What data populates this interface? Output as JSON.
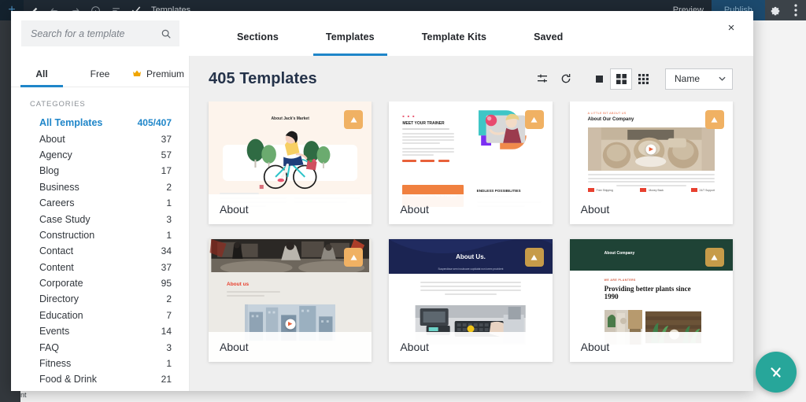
{
  "editor": {
    "add_label": "+",
    "doc_title": "Templates",
    "preview_label": "Preview",
    "publish_label": "Publish",
    "icons": {
      "pencil": "pencil-icon",
      "undo": "undo-icon",
      "redo": "redo-icon",
      "info": "info-icon",
      "history": "history-icon",
      "check": "check-icon",
      "gear": "gear-icon",
      "kebab": "more-vertical-icon"
    },
    "canvas_hint": "nt"
  },
  "search": {
    "placeholder": "Search for a template",
    "value": "",
    "icon": "search-icon"
  },
  "modal": {
    "close_label": "×",
    "tabs": [
      {
        "label": "Sections",
        "active": false
      },
      {
        "label": "Templates",
        "active": true
      },
      {
        "label": "Template Kits",
        "active": false
      },
      {
        "label": "Saved",
        "active": false
      }
    ]
  },
  "sidebar": {
    "filters": [
      {
        "label": "All",
        "active": true,
        "icon": null
      },
      {
        "label": "Free",
        "active": false,
        "icon": null
      },
      {
        "label": "Premium",
        "active": false,
        "icon": "crown-icon"
      }
    ],
    "categories_heading": "CATEGORIES",
    "categories": [
      {
        "name": "All Templates",
        "count": "405/407",
        "active": true
      },
      {
        "name": "About",
        "count": "37",
        "active": false
      },
      {
        "name": "Agency",
        "count": "57",
        "active": false
      },
      {
        "name": "Blog",
        "count": "17",
        "active": false
      },
      {
        "name": "Business",
        "count": "2",
        "active": false
      },
      {
        "name": "Careers",
        "count": "1",
        "active": false
      },
      {
        "name": "Case Study",
        "count": "3",
        "active": false
      },
      {
        "name": "Construction",
        "count": "1",
        "active": false
      },
      {
        "name": "Contact",
        "count": "34",
        "active": false
      },
      {
        "name": "Content",
        "count": "37",
        "active": false
      },
      {
        "name": "Corporate",
        "count": "95",
        "active": false
      },
      {
        "name": "Directory",
        "count": "2",
        "active": false
      },
      {
        "name": "Education",
        "count": "7",
        "active": false
      },
      {
        "name": "Events",
        "count": "14",
        "active": false
      },
      {
        "name": "FAQ",
        "count": "3",
        "active": false
      },
      {
        "name": "Fitness",
        "count": "1",
        "active": false
      },
      {
        "name": "Food & Drink",
        "count": "21",
        "active": false
      }
    ]
  },
  "content": {
    "results_title": "405 Templates",
    "toolbar": {
      "filter_icon": "filter-sliders-icon",
      "refresh_icon": "refresh-icon",
      "view_single_icon": "view-single-icon",
      "view_grid2_icon": "view-grid-2x2-icon",
      "view_grid3_icon": "view-grid-3x3-icon",
      "active_view": "grid2",
      "sort_value": "Name",
      "sort_caret": "∨"
    },
    "cards": [
      {
        "title": "About",
        "badge": "premium-badge-icon",
        "preview_heading": "About Jack's Market",
        "style": "c1"
      },
      {
        "title": "About",
        "badge": "premium-badge-icon",
        "preview_heading": "MEET YOUR TRAINER",
        "preview_subheading": "ENDLESS POSSIBILITIES",
        "style": "c2"
      },
      {
        "title": "About",
        "badge": "premium-badge-icon",
        "preview_eyebrow": "A LITTLE BIT ABOUT US",
        "preview_heading": "About Our Company",
        "preview_features": [
          "Free Shipping",
          "Money Back",
          "24/7 Support"
        ],
        "style": "c3"
      },
      {
        "title": "About",
        "badge": "premium-badge-icon",
        "preview_heading": "About us",
        "style": "c4"
      },
      {
        "title": "About",
        "badge": "premium-badge-icon",
        "preview_heading": "About Us.",
        "preview_subheading": "Suspendisse sem incubuare cupidatat non lorem provident",
        "style": "c5"
      },
      {
        "title": "About",
        "badge": "premium-badge-icon",
        "preview_heading": "About Company",
        "preview_eyebrow": "WE ARE PLANTERS",
        "preview_subheading": "Providing better plants since 1990",
        "style": "c6"
      }
    ]
  },
  "fab": {
    "icon": "check-fab-icon",
    "label": "✕"
  },
  "colors": {
    "accent_blue": "#1f86c9",
    "premium_orange": "#f0b163",
    "fab_teal": "#27a69a",
    "title_navy": "#25334a"
  }
}
